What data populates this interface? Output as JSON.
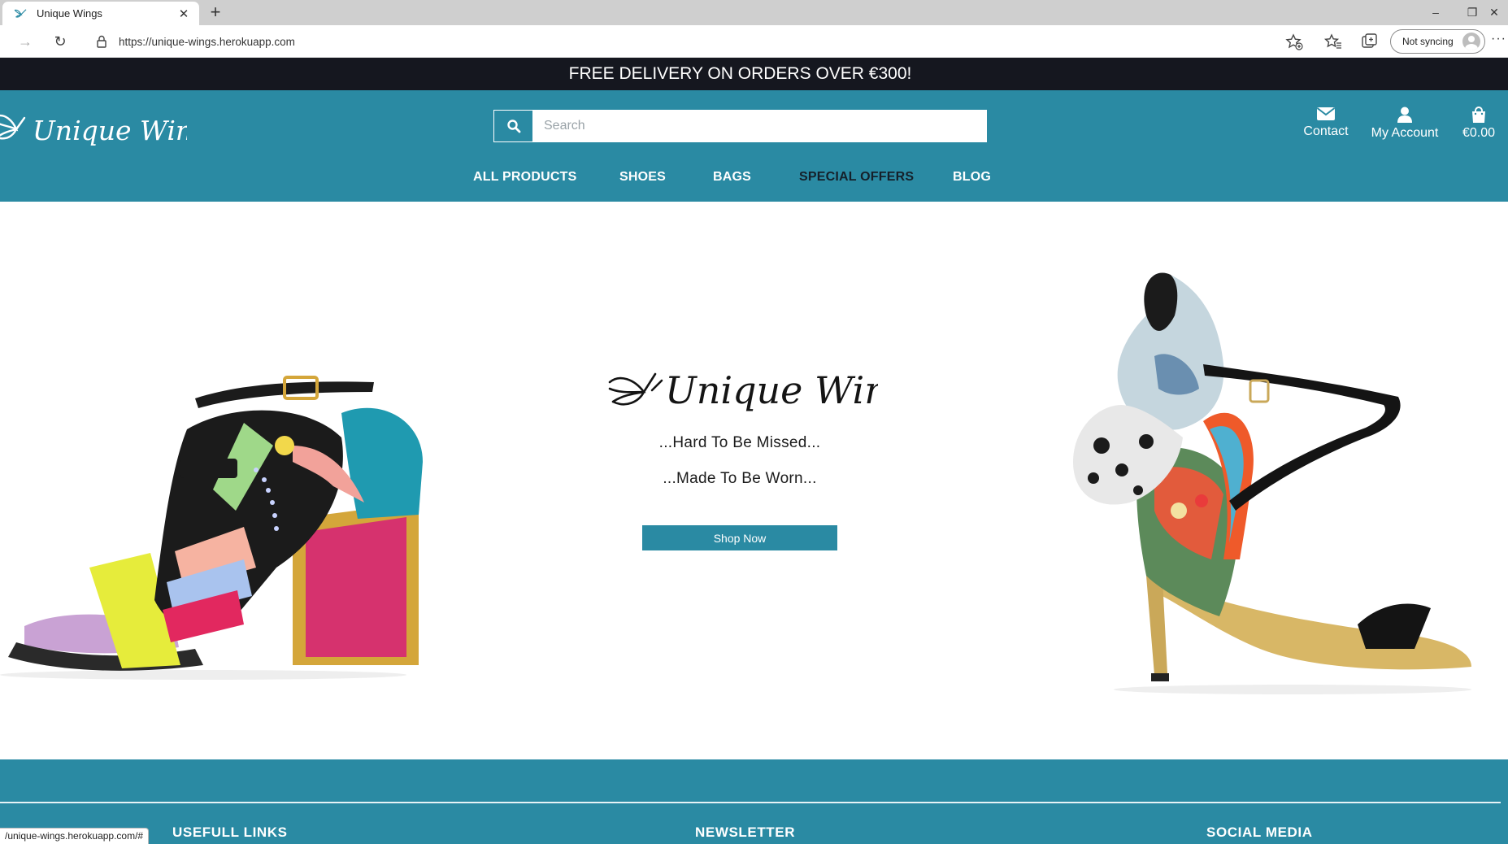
{
  "browser": {
    "tab": {
      "title": "Unique Wings",
      "close": "✕"
    },
    "new_tab": "+",
    "window": {
      "minimize": "–",
      "restore": "❐",
      "close": "✕"
    },
    "nav": {
      "back": "→",
      "refresh": "↻"
    },
    "url": "https://unique-wings.herokuapp.com",
    "sync_label": "Not syncing",
    "more": "···",
    "status_url": "/unique-wings.herokuapp.com/#"
  },
  "site": {
    "announcement": "FREE DELIVERY ON ORDERS OVER €300!",
    "brand": "Unique Wings",
    "search": {
      "placeholder": "Search",
      "value": ""
    },
    "header_links": [
      {
        "label": "Contact",
        "icon": "envelope-icon"
      },
      {
        "label": "My Account",
        "icon": "user-icon"
      },
      {
        "label": "€0.00",
        "icon": "shopping-bag-icon"
      }
    ],
    "nav": [
      "ALL PRODUCTS",
      "SHOES",
      "BAGS",
      "SPECIAL OFFERS",
      "BLOG"
    ],
    "hero": {
      "tagline_1": "...Hard To Be Missed...",
      "tagline_2": "...Made To Be Worn...",
      "cta": "Shop Now"
    },
    "footer": {
      "headings": [
        "USEFULL LINKS",
        "NEWSLETTER",
        "SOCIAL MEDIA"
      ]
    }
  },
  "colors": {
    "brand_teal": "#2a8aa3",
    "announcement_bg": "#15171f",
    "special_offers_text": "#15202a"
  }
}
